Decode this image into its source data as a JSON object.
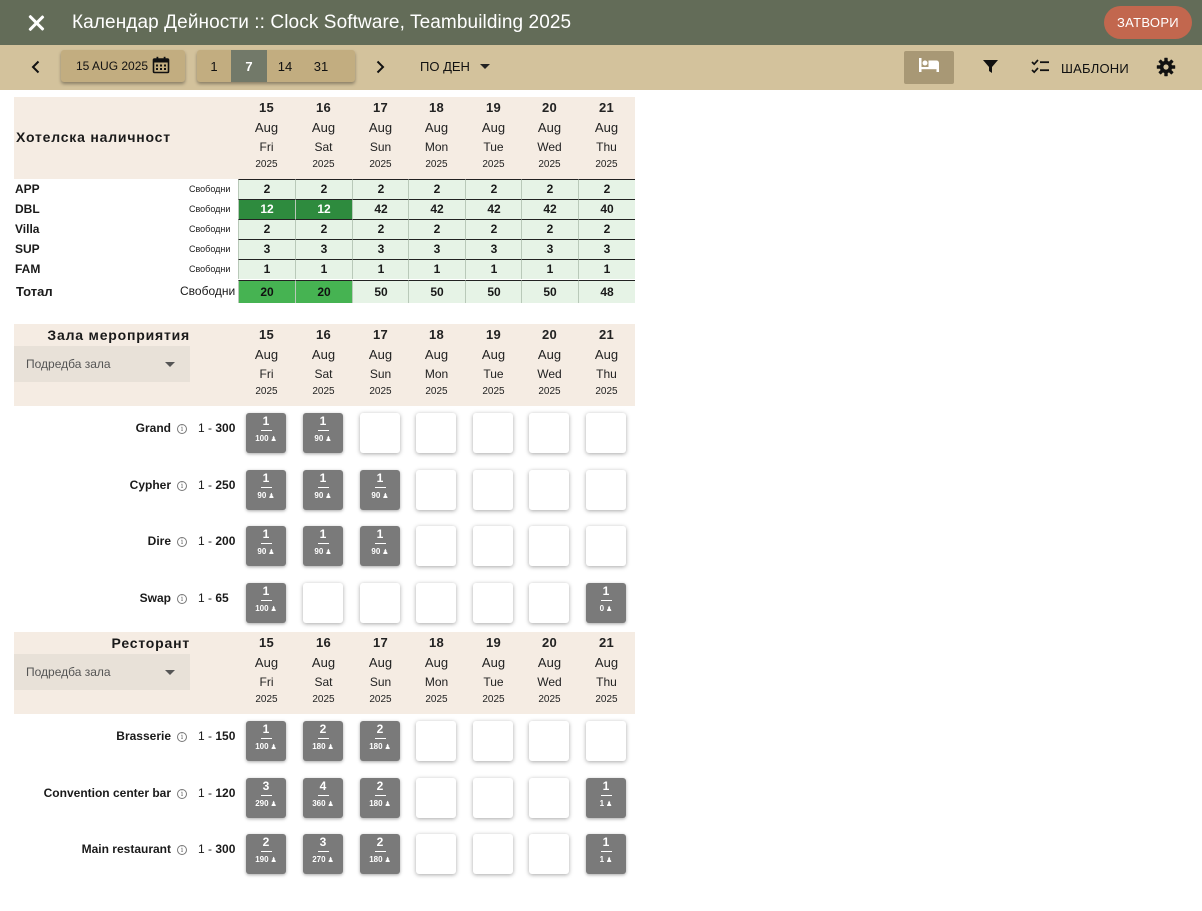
{
  "app": {
    "title": "Календар Дейности :: Clock Software, Teambuilding 2025",
    "close_label": "ЗАТВОРИ"
  },
  "toolbar": {
    "date": "15 AUG 2025",
    "ranges": [
      "1",
      "7",
      "14",
      "31"
    ],
    "active_range": "7",
    "view_mode": "ПО ДЕН",
    "templates_label": "ШАБЛОНИ"
  },
  "days": [
    {
      "d": "15",
      "m": "Aug",
      "w": "Fri",
      "y": "2025"
    },
    {
      "d": "16",
      "m": "Aug",
      "w": "Sat",
      "y": "2025"
    },
    {
      "d": "17",
      "m": "Aug",
      "w": "Sun",
      "y": "2025"
    },
    {
      "d": "18",
      "m": "Aug",
      "w": "Mon",
      "y": "2025"
    },
    {
      "d": "19",
      "m": "Aug",
      "w": "Tue",
      "y": "2025"
    },
    {
      "d": "20",
      "m": "Aug",
      "w": "Wed",
      "y": "2025"
    },
    {
      "d": "21",
      "m": "Aug",
      "w": "Thu",
      "y": "2025"
    }
  ],
  "hotel": {
    "title": "Хотелска наличност",
    "rows": [
      {
        "name": "APP",
        "label": "Свободни",
        "values": [
          "2",
          "2",
          "2",
          "2",
          "2",
          "2",
          "2"
        ],
        "style": [
          "",
          "",
          "",
          "",
          "",
          "",
          ""
        ]
      },
      {
        "name": "DBL",
        "label": "Свободни",
        "values": [
          "12",
          "12",
          "42",
          "42",
          "42",
          "42",
          "40"
        ],
        "style": [
          "dark",
          "dark",
          "",
          "",
          "",
          "",
          ""
        ]
      },
      {
        "name": "Villa",
        "label": "Свободни",
        "values": [
          "2",
          "2",
          "2",
          "2",
          "2",
          "2",
          "2"
        ],
        "style": [
          "",
          "",
          "",
          "",
          "",
          "",
          ""
        ]
      },
      {
        "name": "SUP",
        "label": "Свободни",
        "values": [
          "3",
          "3",
          "3",
          "3",
          "3",
          "3",
          "3"
        ],
        "style": [
          "",
          "",
          "",
          "",
          "",
          "",
          ""
        ]
      },
      {
        "name": "FAM",
        "label": "Свободни",
        "values": [
          "1",
          "1",
          "1",
          "1",
          "1",
          "1",
          "1"
        ],
        "style": [
          "",
          "",
          "",
          "",
          "",
          "",
          ""
        ]
      }
    ],
    "total": {
      "name": "Тотал",
      "label": "Свободни",
      "values": [
        "20",
        "20",
        "50",
        "50",
        "50",
        "50",
        "48"
      ],
      "style": [
        "green",
        "green",
        "",
        "",
        "",
        "",
        ""
      ]
    }
  },
  "events": {
    "title": "Зала мероприятия",
    "layout_placeholder": "Подредба зала",
    "rooms": [
      {
        "name": "Grand",
        "cap_min": "1",
        "cap_max": "300",
        "slots": [
          [
            "1",
            "100"
          ],
          [
            "1",
            "90"
          ],
          null,
          null,
          null,
          null,
          null
        ]
      },
      {
        "name": "Cypher",
        "cap_min": "1",
        "cap_max": "250",
        "slots": [
          [
            "1",
            "90"
          ],
          [
            "1",
            "90"
          ],
          [
            "1",
            "90"
          ],
          null,
          null,
          null,
          null
        ]
      },
      {
        "name": "Dire",
        "cap_min": "1",
        "cap_max": "200",
        "slots": [
          [
            "1",
            "90"
          ],
          [
            "1",
            "90"
          ],
          [
            "1",
            "90"
          ],
          null,
          null,
          null,
          null
        ]
      },
      {
        "name": "Swap",
        "cap_min": "1",
        "cap_max": "65",
        "slots": [
          [
            "1",
            "100"
          ],
          null,
          null,
          null,
          null,
          null,
          [
            "1",
            "0"
          ]
        ]
      }
    ]
  },
  "restaurant": {
    "title": "Ресторант",
    "layout_placeholder": "Подредба зала",
    "rooms": [
      {
        "name": "Brasserie",
        "cap_min": "1",
        "cap_max": "150",
        "slots": [
          [
            "1",
            "100"
          ],
          [
            "2",
            "180"
          ],
          [
            "2",
            "180"
          ],
          null,
          null,
          null,
          null
        ]
      },
      {
        "name": "Convention center bar",
        "cap_min": "1",
        "cap_max": "120",
        "slots": [
          [
            "3",
            "290"
          ],
          [
            "4",
            "360"
          ],
          [
            "2",
            "180"
          ],
          null,
          null,
          null,
          [
            "1",
            "1"
          ]
        ]
      },
      {
        "name": "Main restaurant",
        "cap_min": "1",
        "cap_max": "300",
        "slots": [
          [
            "2",
            "190"
          ],
          [
            "3",
            "270"
          ],
          [
            "2",
            "180"
          ],
          null,
          null,
          null,
          [
            "1",
            "1"
          ]
        ]
      }
    ]
  },
  "colors": {
    "appbar": "#636c58",
    "toolbar": "#d3c29c",
    "close_button": "#c2674e",
    "header_band": "#f5ece3",
    "avail_light": "#e6f3e6",
    "avail_dark": "#2e8b3e",
    "avail_green": "#46b352",
    "slot_busy": "#7a7a7a"
  },
  "icons": [
    "close-icon",
    "chevron-left-icon",
    "calendar-icon",
    "chevron-right-icon",
    "dropdown-caret-icon",
    "bed-icon",
    "filter-icon",
    "checklist-icon",
    "gear-icon",
    "info-icon",
    "person-icon"
  ]
}
